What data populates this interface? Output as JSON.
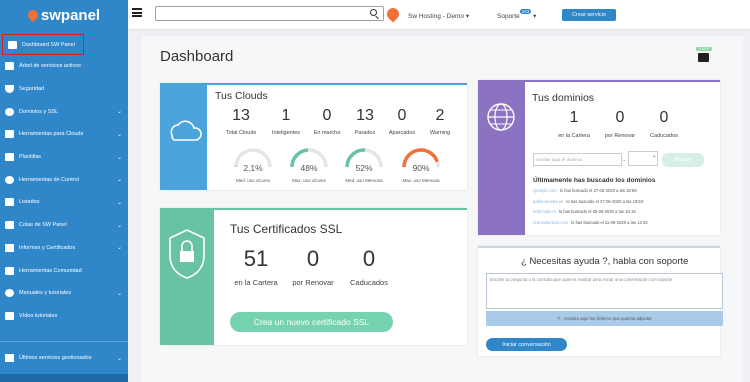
{
  "app": {
    "brand": "swpanel"
  },
  "sidebar": {
    "items": [
      {
        "label": "Dashboard SW Panel",
        "icon": "dashboard-icon",
        "has_submenu": false
      },
      {
        "label": "Árbol de servicios activos",
        "icon": "tree-icon",
        "has_submenu": false
      },
      {
        "label": "Seguridad",
        "icon": "shield-icon",
        "has_submenu": false
      },
      {
        "label": "Dominios y SSL",
        "icon": "globe-icon",
        "has_submenu": true
      },
      {
        "label": "Herramientas para Clouds",
        "icon": "toolbox-icon",
        "has_submenu": true
      },
      {
        "label": "Plantillas",
        "icon": "file-icon",
        "has_submenu": true
      },
      {
        "label": "Herramientas de Control",
        "icon": "check-circle-icon",
        "has_submenu": true
      },
      {
        "label": "Listados",
        "icon": "list-icon",
        "has_submenu": true
      },
      {
        "label": "Colas de SW Panel",
        "icon": "layers-icon",
        "has_submenu": true
      },
      {
        "label": "Informes y Certificados",
        "icon": "report-icon",
        "has_submenu": true
      },
      {
        "label": "Herramientas Comunidad",
        "icon": "tools-icon",
        "has_submenu": false
      },
      {
        "label": "Manuales y tutoriales",
        "icon": "question-icon",
        "has_submenu": true
      },
      {
        "label": "Vídeo tutoriales",
        "icon": "video-icon",
        "has_submenu": false
      }
    ],
    "bottom_item": "Últimos servicios gestionados"
  },
  "topbar": {
    "search_value": "",
    "account": "Sw Hosting - Demo",
    "account_caret": "▾",
    "soporte": "Soporte",
    "soporte_badge": "243",
    "soporte_caret": "▾",
    "crear_button": "Crear servicio"
  },
  "dashboard": {
    "title": "Dashboard",
    "wallet_badge": "0,00 €",
    "clouds": {
      "title": "Tus Clouds",
      "stats": [
        {
          "value": "13",
          "label": "Total Clouds"
        },
        {
          "value": "1",
          "label": "Inteligentes"
        },
        {
          "value": "0",
          "label": "En marcha"
        },
        {
          "value": "13",
          "label": "Parados"
        },
        {
          "value": "0",
          "label": "Aparcados"
        },
        {
          "value": "2",
          "label": "Warning"
        }
      ],
      "gauges": [
        {
          "percent_text": "2,1%",
          "fraction": 0.021,
          "label": "Med. uso vCores",
          "color": "#c9ccd1"
        },
        {
          "percent_text": "48%",
          "fraction": 0.48,
          "label": "Max. uso vCores",
          "color": "#68c3a5"
        },
        {
          "percent_text": "52%",
          "fraction": 0.52,
          "label": "Med. uso Memoria",
          "color": "#68c3a5"
        },
        {
          "percent_text": "90%",
          "fraction": 0.9,
          "label": "Max. uso Memoria",
          "color": "#f07136"
        }
      ]
    },
    "dominios": {
      "title": "Tus dominios",
      "stats": [
        {
          "value": "1",
          "label": "en la Cartera"
        },
        {
          "value": "0",
          "label": "por Renovar"
        },
        {
          "value": "0",
          "label": "Caducados"
        }
      ],
      "search_placeholder": "escribe aquí el dominio",
      "tld_value": "",
      "search_button": "Buscar",
      "recent_title": "Últimamente has buscado los dominios",
      "recent": [
        {
          "domain": "ejemplo.com",
          "text": "lo has buscado el 27-06-2020 a las 18:59"
        },
        {
          "domain": "pablo-prueba.es",
          "text": "lo has buscado el 27-06-2020 a las 18:53"
        },
        {
          "domain": "hola-hola.es",
          "text": "lo has buscado el 25-06-2020 a las 10:18"
        },
        {
          "domain": "nuevodominio.com",
          "text": "lo has buscado el 11-06-2020 a las 13:42"
        }
      ]
    },
    "ssl": {
      "title": "Tus Certificados SSL",
      "stats": [
        {
          "value": "51",
          "label": "en la Cartera"
        },
        {
          "value": "0",
          "label": "por Renovar"
        },
        {
          "value": "0",
          "label": "Caducados"
        }
      ],
      "create_button": "Crea un nuevo certificado SSL"
    },
    "help": {
      "title": "¿ Necesitas ayuda ?, habla con soporte",
      "textarea_placeholder": "Escribe tu pregunta o la consulta que quieres realizar para iniciar una conversación con soporte",
      "attach_label": "Arrastra aquí los ficheros que quieras adjuntar",
      "start_button": "Iniciar conversación"
    }
  }
}
